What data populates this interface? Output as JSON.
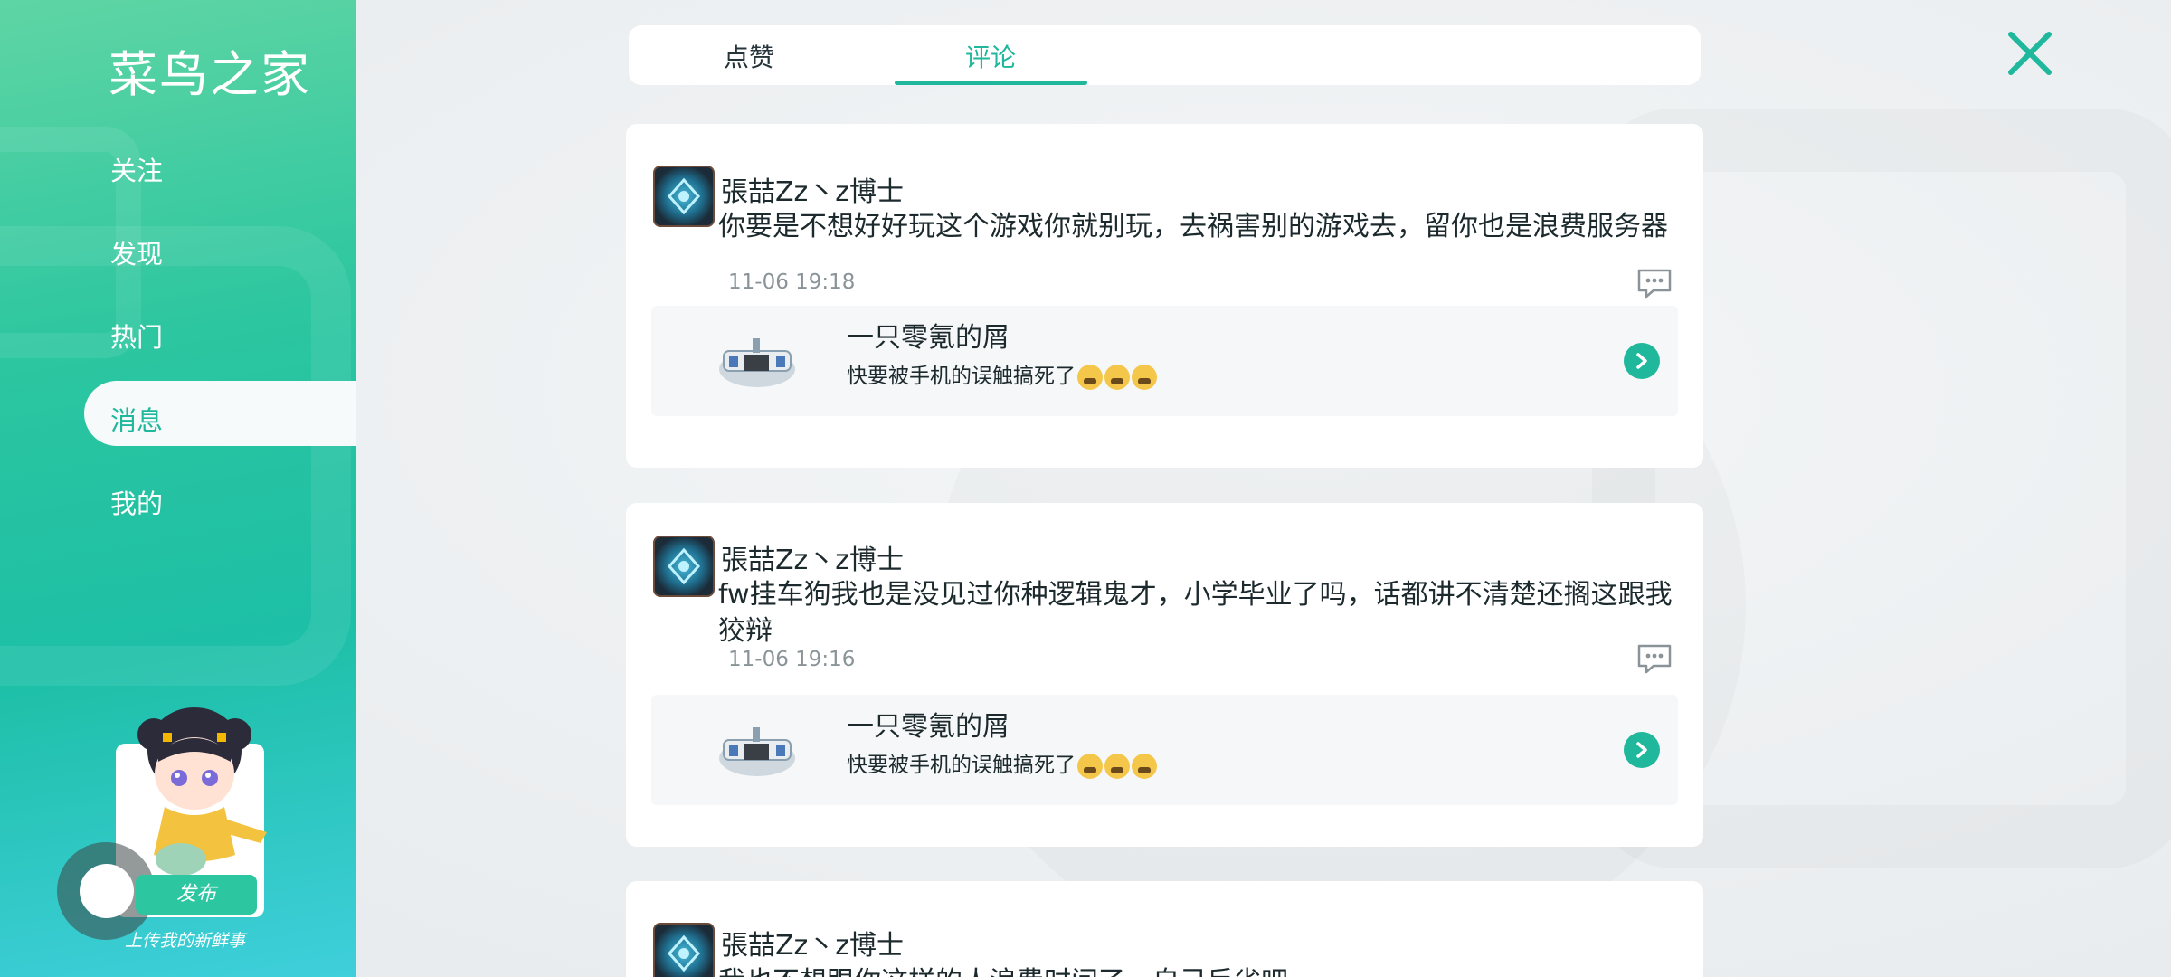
{
  "app": {
    "title": "菜鸟之家"
  },
  "sidebar": {
    "items": [
      {
        "label": "关注"
      },
      {
        "label": "发现"
      },
      {
        "label": "热门"
      },
      {
        "label": "消息",
        "active": true
      },
      {
        "label": "我的"
      }
    ],
    "publish_label": "发布",
    "upload_caption": "上传我的新鲜事"
  },
  "tabs": [
    {
      "label": "点赞"
    },
    {
      "label": "评论",
      "active": true
    }
  ],
  "comments": [
    {
      "username": "張喆Zz丶z博士",
      "text": "你要是不想好好玩这个游戏你就别玩，去祸害别的游戏去，留你也是浪费服务器",
      "time": "11-06 19:18",
      "post": {
        "title": "一只零氪的屑",
        "snippet": "快要被手机的误触搞死了"
      }
    },
    {
      "username": "張喆Zz丶z博士",
      "text": "fw挂车狗我也是没见过你种逻辑鬼才，小学毕业了吗，话都讲不清楚还搁这跟我狡辩",
      "time": "11-06 19:16",
      "post": {
        "title": "一只零氪的屑",
        "snippet": "快要被手机的误触搞死了"
      }
    },
    {
      "username": "張喆Zz丶z博士",
      "text": "我也不想跟你这样的人浪费时间了，自己反省吧"
    }
  ],
  "colors": {
    "accent": "#1fb89c",
    "sidebar_top": "#5fd5a4",
    "sidebar_bottom": "#3fcfdc"
  },
  "icons": {
    "close": "close-icon",
    "reply": "comment-bubble-icon",
    "go": "chevron-right-icon"
  }
}
